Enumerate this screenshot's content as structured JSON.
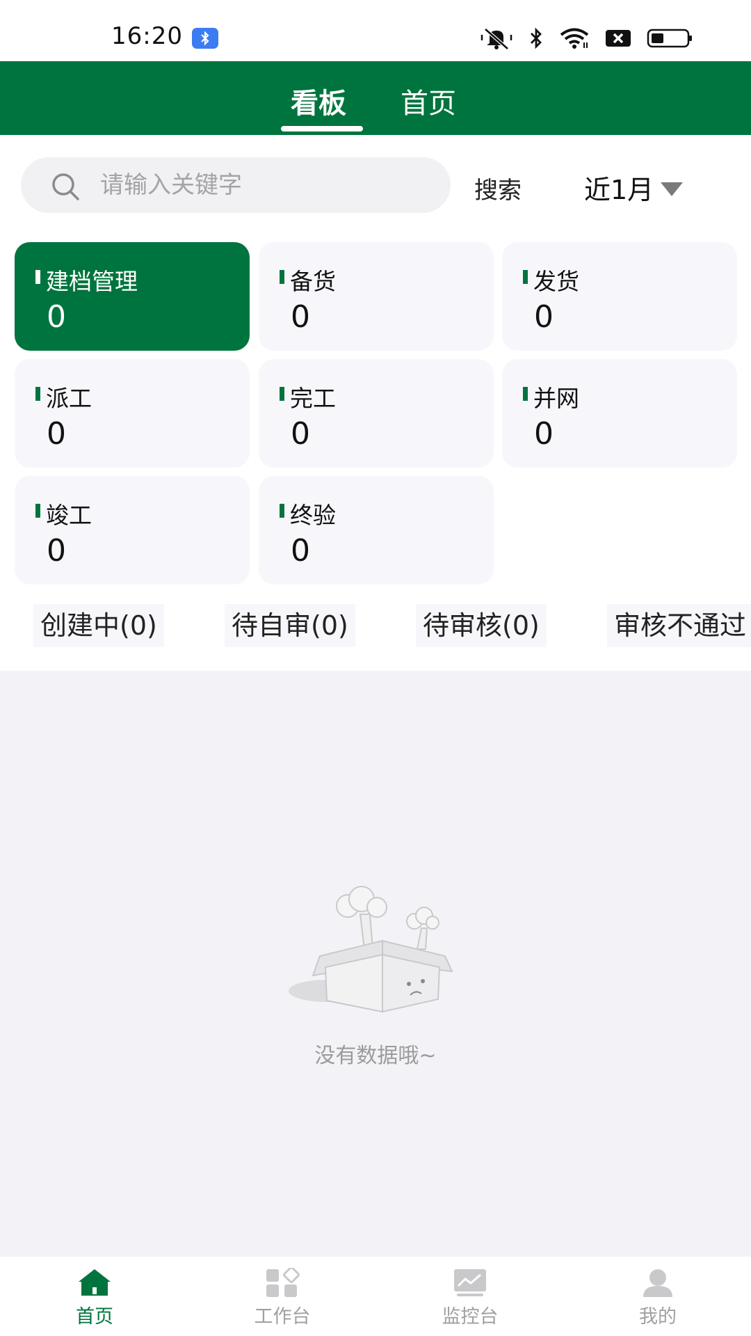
{
  "status_bar": {
    "time": "16:20",
    "icons": [
      "bluetooth-badge-icon",
      "mute-icon",
      "bluetooth-icon",
      "wifi-icon",
      "sim-x-icon",
      "battery-icon"
    ],
    "battery_level": 0.35
  },
  "header": {
    "tabs": [
      {
        "label": "看板",
        "active": true
      },
      {
        "label": "首页",
        "active": false
      }
    ],
    "background_color": "#00743e"
  },
  "search": {
    "placeholder": "请输入关键字",
    "value": "",
    "button_label": "搜索",
    "range_label": "近1月"
  },
  "cards": [
    {
      "label": "建档管理",
      "value": "0",
      "active": true
    },
    {
      "label": "备货",
      "value": "0",
      "active": false
    },
    {
      "label": "发货",
      "value": "0",
      "active": false
    },
    {
      "label": "派工",
      "value": "0",
      "active": false
    },
    {
      "label": "完工",
      "value": "0",
      "active": false
    },
    {
      "label": "并网",
      "value": "0",
      "active": false
    },
    {
      "label": "竣工",
      "value": "0",
      "active": false
    },
    {
      "label": "终验",
      "value": "0",
      "active": false
    }
  ],
  "filter_chips": [
    {
      "label": "创建中(0)"
    },
    {
      "label": "待自审(0)"
    },
    {
      "label": "待审核(0)"
    },
    {
      "label": "审核不通过"
    }
  ],
  "empty_state": {
    "text": "没有数据哦~",
    "icon": "empty-box-icon"
  },
  "bottom_nav": [
    {
      "label": "首页",
      "icon": "home-icon",
      "active": true
    },
    {
      "label": "工作台",
      "icon": "workbench-icon",
      "active": false
    },
    {
      "label": "监控台",
      "icon": "monitor-icon",
      "active": false
    },
    {
      "label": "我的",
      "icon": "user-icon",
      "active": false
    }
  ],
  "colors": {
    "accent": "#00743e",
    "card_bg": "#f7f7fb",
    "empty_bg": "#f3f3f7"
  }
}
